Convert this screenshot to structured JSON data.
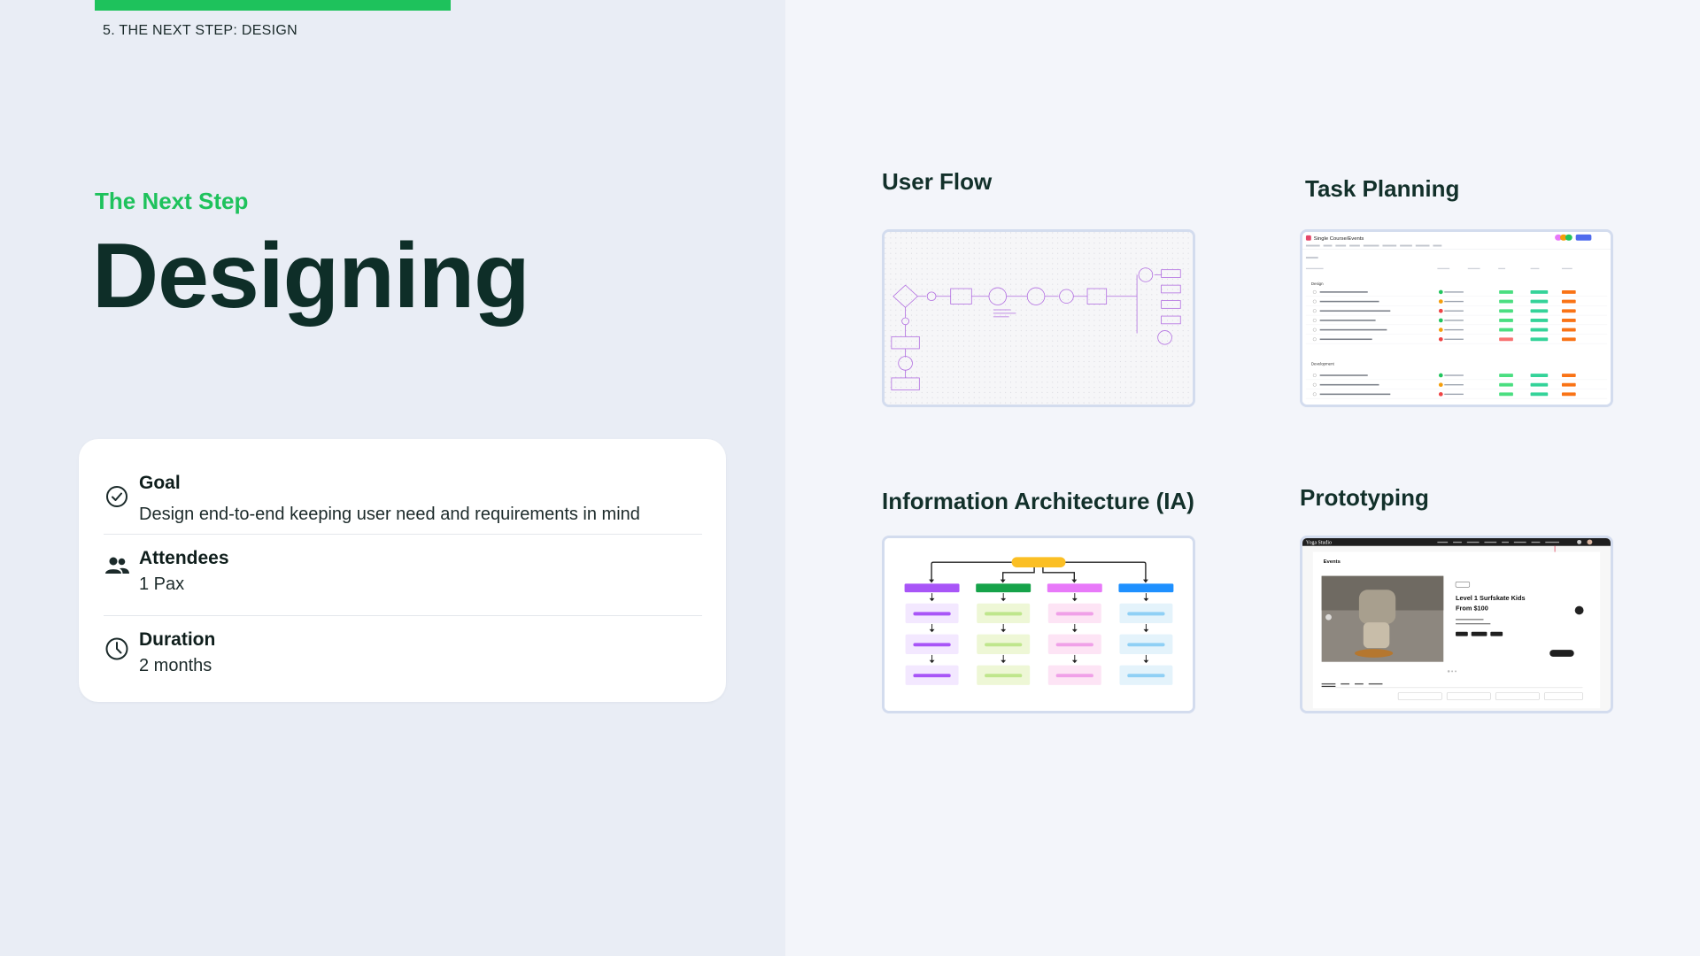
{
  "header": {
    "section_label": "5. THE NEXT STEP: DESIGN"
  },
  "hero": {
    "eyebrow": "The Next Step",
    "headline": "Designing"
  },
  "info_card": {
    "goal": {
      "title": "Goal",
      "description": "Design end-to-end keeping user need and requirements in mind",
      "icon": "check-circle-icon"
    },
    "attendees": {
      "title": "Attendees",
      "description": "1 Pax",
      "icon": "people-icon"
    },
    "duration": {
      "title": "Duration",
      "description": "2 months",
      "icon": "clock-icon"
    }
  },
  "tiles": {
    "user_flow": {
      "title": "User Flow"
    },
    "task_planning": {
      "title": "Task Planning",
      "project_name": "Single Course/Events",
      "groups": [
        "Design",
        "Development"
      ]
    },
    "information_architecture": {
      "title": "Information Architecture (IA)"
    },
    "prototyping": {
      "title": "Prototyping",
      "brand": "Yoga Studio",
      "section": "Events",
      "event_title_line1": "Level 1 Surfskate Kids",
      "event_title_line2": "From $100"
    }
  },
  "colors": {
    "accent_green": "#1ec25c",
    "headline": "#0e2e28",
    "left_panel_bg": "#e9edf5",
    "right_panel_bg": "#f3f5fa",
    "ia_purple": "#a855f7",
    "ia_green": "#16a34a",
    "ia_pink": "#e879f9",
    "ia_blue": "#1e90ff",
    "ia_yellow": "#fbbf24"
  }
}
